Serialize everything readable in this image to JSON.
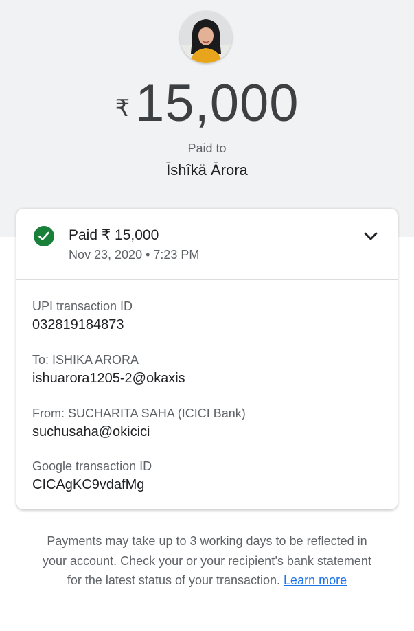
{
  "header": {
    "currency_symbol": "₹",
    "amount": "15,000",
    "paid_to_label": "Paid to",
    "payee_name": "Īshîkä Ārora"
  },
  "status": {
    "icon": "check-circle-icon",
    "title": "Paid ₹ 15,000",
    "datetime": "Nov 23, 2020 • 7:23 PM",
    "color": "#188038"
  },
  "details": [
    {
      "label": "UPI transaction ID",
      "value": "032819184873"
    },
    {
      "label": "To: ISHIKA  ARORA",
      "value": "ishuarora1205-2@okaxis"
    },
    {
      "label": "From: SUCHARITA SAHA (ICICI Bank)",
      "value": "suchusaha@okicici"
    },
    {
      "label": "Google transaction ID",
      "value": "CICAgKC9vdafMg"
    }
  ],
  "footer": {
    "note": "Payments may take up to 3 working days to be reflected in your account. Check your or your recipient’s bank statement for the latest status of your transaction. ",
    "link": "Learn more",
    "link_color": "#1a73e8"
  }
}
